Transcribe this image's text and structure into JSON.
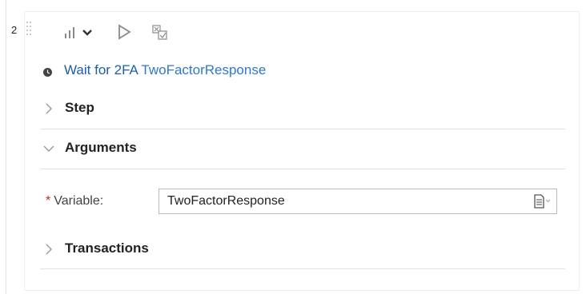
{
  "step": {
    "number": "2",
    "title_verb": "Wait for 2FA",
    "title_argument": "TwoFactorResponse"
  },
  "toolbar": {
    "icons": [
      "bar-chart-icon",
      "chevron-down-icon",
      "play-icon",
      "checkbox-icon"
    ]
  },
  "sections": [
    {
      "label": "Step",
      "expanded": false
    },
    {
      "label": "Arguments",
      "expanded": true
    },
    {
      "label": "Transactions",
      "expanded": false
    }
  ],
  "arguments": {
    "required_marker": "*",
    "variable_label": "Variable:",
    "variable_value": "TwoFactorResponse"
  },
  "colors": {
    "link": "#2d79c7",
    "required": "#c62828",
    "icon_gray": "#777777"
  }
}
